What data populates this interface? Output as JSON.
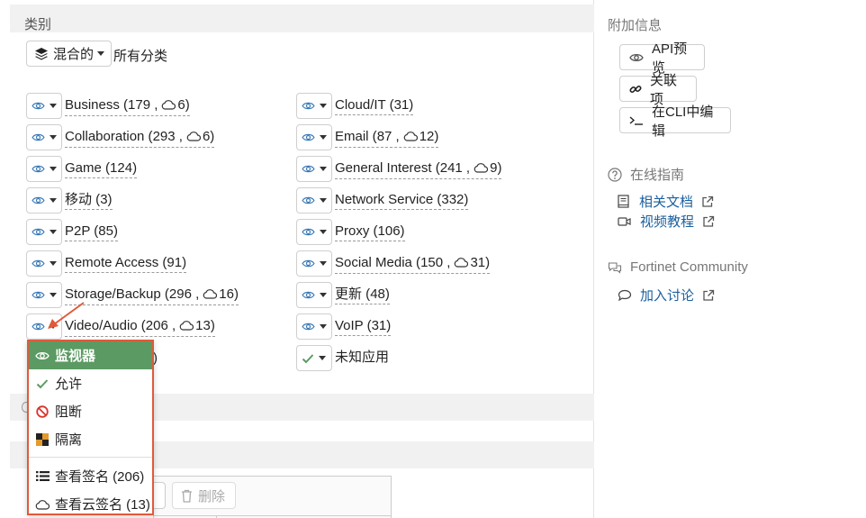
{
  "category_section": {
    "title": "类别",
    "mix_button": "混合的",
    "all_label": "所有分类"
  },
  "categories_left": [
    {
      "name": "Business",
      "count": "179",
      "cloud": "6"
    },
    {
      "name": "Collaboration",
      "count": "293",
      "cloud": "6"
    },
    {
      "name": "Game",
      "count": "124",
      "cloud": ""
    },
    {
      "name": "移动",
      "count": "3",
      "cloud": ""
    },
    {
      "name": "P2P",
      "count": "85",
      "cloud": ""
    },
    {
      "name": "Remote Access",
      "count": "91",
      "cloud": ""
    },
    {
      "name": "Storage/Backup",
      "count": "296",
      "cloud": "16"
    },
    {
      "name": "Video/Audio",
      "count": "206",
      "cloud": "13"
    }
  ],
  "categories_right": [
    {
      "name": "Cloud/IT",
      "count": "31",
      "cloud": ""
    },
    {
      "name": "Email",
      "count": "87",
      "cloud": "12"
    },
    {
      "name": "General Interest",
      "count": "241",
      "cloud": "9"
    },
    {
      "name": "Network Service",
      "count": "332",
      "cloud": ""
    },
    {
      "name": "Proxy",
      "count": "106",
      "cloud": ""
    },
    {
      "name": "Social Media",
      "count": "150",
      "cloud": "31"
    },
    {
      "name": "更新",
      "count": "48",
      "cloud": ""
    },
    {
      "name": "VoIP",
      "count": "31",
      "cloud": ""
    },
    {
      "name": "未知应用",
      "count": "",
      "cloud": ""
    }
  ],
  "partial_hidden_text": ")",
  "dropdown": {
    "items": [
      {
        "label": "监视器",
        "icon": "eye-icon"
      },
      {
        "label": "允许",
        "icon": "check-icon"
      },
      {
        "label": "阻断",
        "icon": "block-icon"
      },
      {
        "label": "隔离",
        "icon": "quarantine-icon"
      }
    ],
    "actions": [
      {
        "label": "查看签名 (206)",
        "icon": "list-icon"
      },
      {
        "label": "查看云签名 (13)",
        "icon": "cloud-icon"
      }
    ]
  },
  "toolbar_fragment": {
    "delete_label": "删除"
  },
  "sidebar": {
    "additional_info_title": "附加信息",
    "buttons": [
      "API预览",
      "关联项",
      "在CLI中编辑"
    ],
    "online_guide_title": "在线指南",
    "guide_links": [
      "相关文档",
      "视频教程"
    ],
    "community_title": "Fortinet Community",
    "community_link": "加入讨论"
  },
  "colors": {
    "monitor_green": "#5b9a62",
    "link_blue": "#1a5f9e",
    "highlight_red": "#e05a3a",
    "eye_blue": "#3b7ab8"
  }
}
